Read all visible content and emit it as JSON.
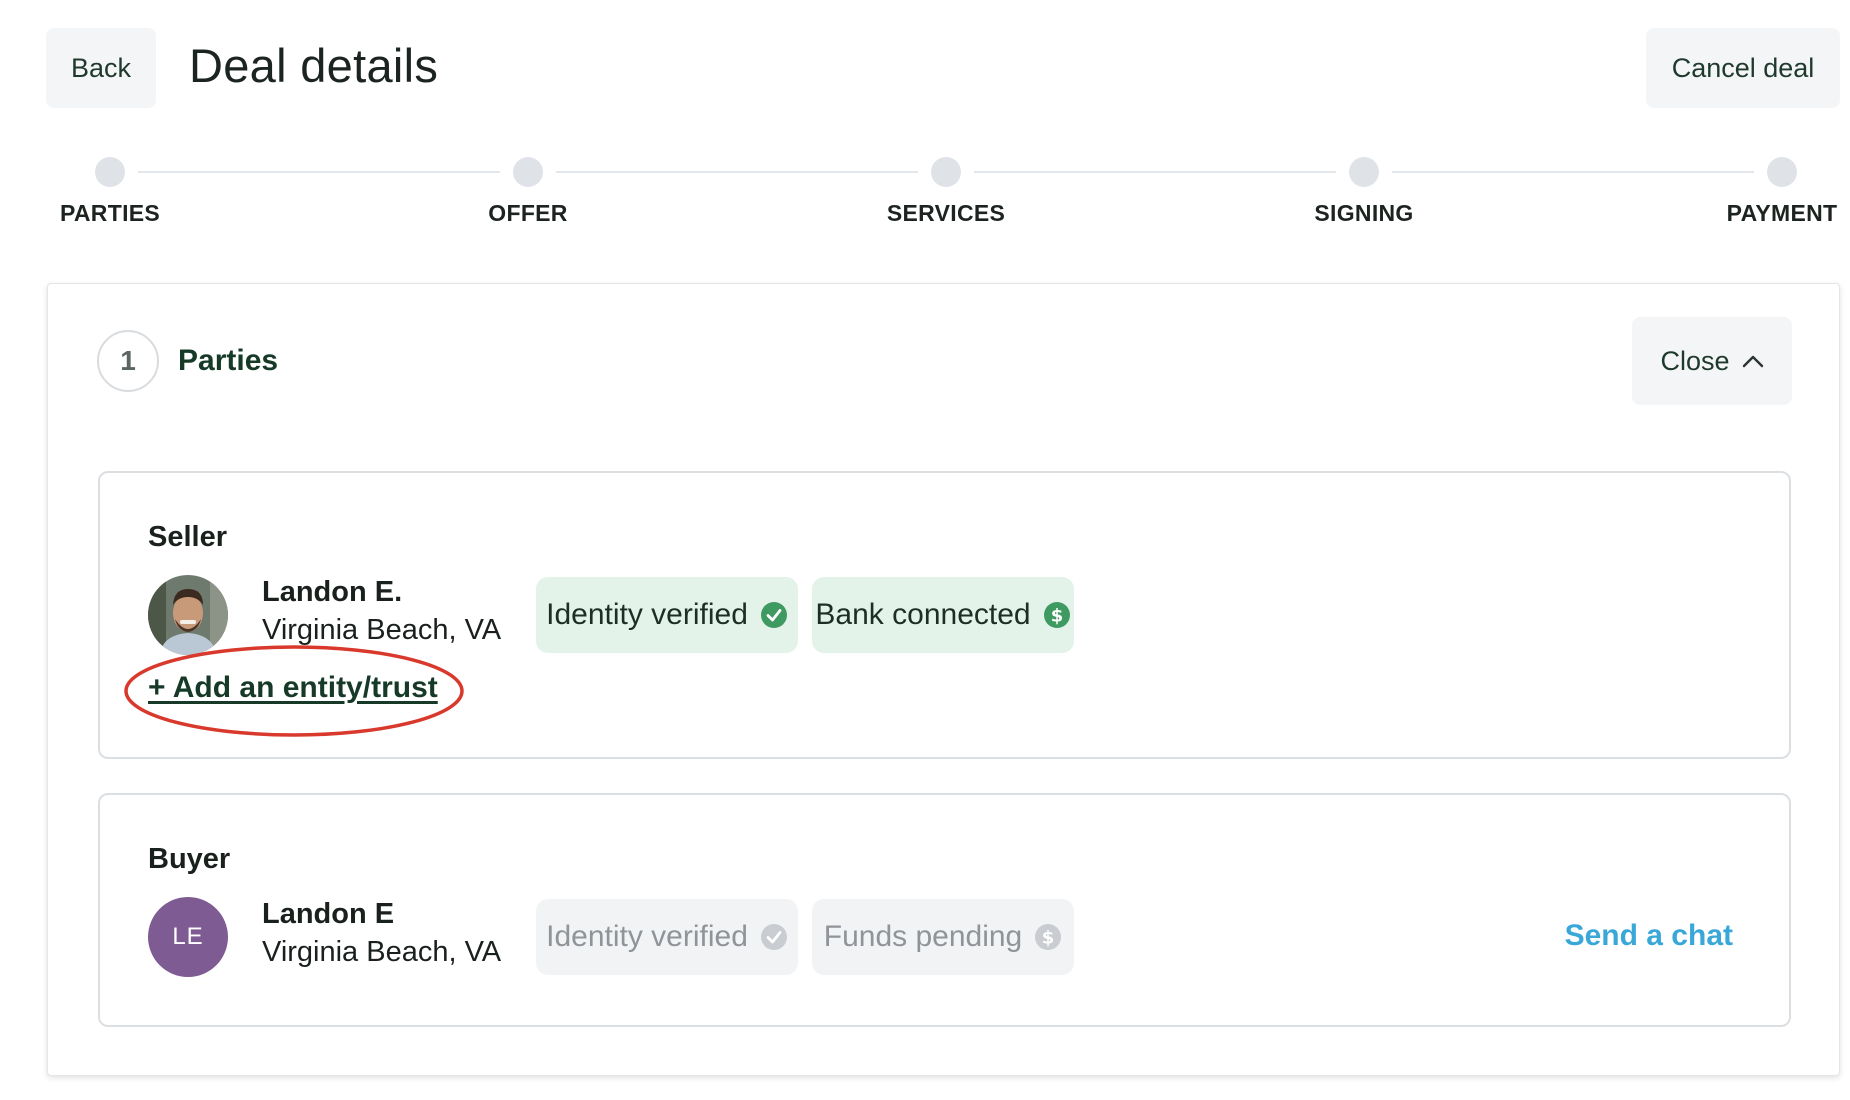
{
  "header": {
    "back_label": "Back",
    "title": "Deal details",
    "cancel_label": "Cancel deal"
  },
  "stepper": {
    "steps": [
      {
        "label": "PARTIES"
      },
      {
        "label": "OFFER"
      },
      {
        "label": "SERVICES"
      },
      {
        "label": "SIGNING"
      },
      {
        "label": "PAYMENT"
      }
    ]
  },
  "section": {
    "number": "1",
    "title": "Parties",
    "close_label": "Close",
    "close_icon": "chevron-up-icon"
  },
  "seller": {
    "role": "Seller",
    "name": "Landon E.",
    "location": "Virginia Beach, VA",
    "avatar": "profile-photo",
    "badges": [
      {
        "label": "Identity verified",
        "icon": "check-circle-icon",
        "status": "complete"
      },
      {
        "label": "Bank connected",
        "icon": "dollar-circle-icon",
        "status": "complete"
      }
    ],
    "add_entity_label": "+ Add an entity/trust"
  },
  "buyer": {
    "role": "Buyer",
    "name": "Landon E",
    "location": "Virginia Beach, VA",
    "avatar_initials": "LE",
    "badges": [
      {
        "label": "Identity verified",
        "icon": "check-circle-icon",
        "status": "pending"
      },
      {
        "label": "Funds pending",
        "icon": "dollar-circle-icon",
        "status": "pending"
      }
    ],
    "chat_label": "Send a chat"
  },
  "colors": {
    "accent_green": "#173a28",
    "verified_green": "#3f9a62",
    "badge_green_bg": "#e3f3ea",
    "badge_gray_bg": "#f2f3f4",
    "link_blue": "#3aa7d9",
    "avatar_purple": "#7e5b92",
    "annotation_red": "#d9392c"
  }
}
